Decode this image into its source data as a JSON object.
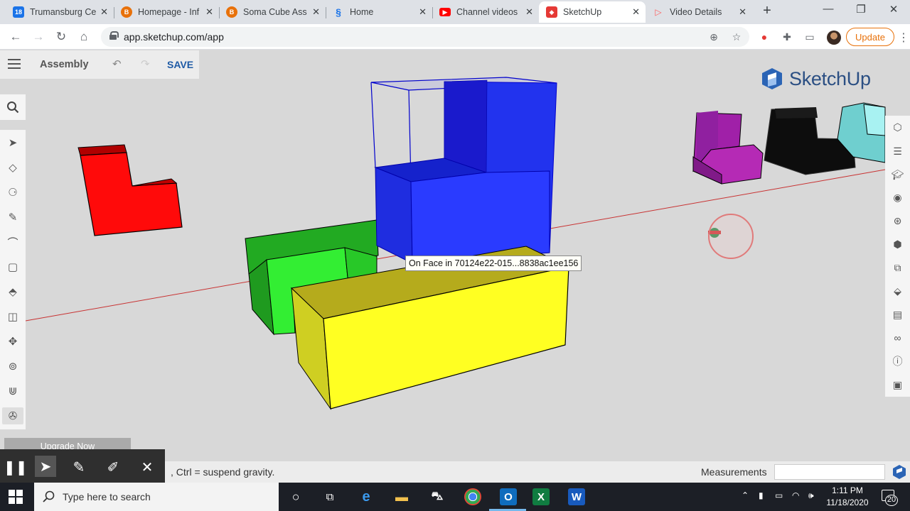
{
  "browser": {
    "tabs": [
      {
        "title": "Trumansburg Ce",
        "icon": "calendar-favicon",
        "color": "#1a73e8",
        "active": false
      },
      {
        "title": "Homepage - Inf",
        "icon": "orange-b-favicon",
        "color": "#e8710a",
        "active": false
      },
      {
        "title": "Soma Cube Ass",
        "icon": "orange-b-favicon",
        "color": "#e8710a",
        "active": false
      },
      {
        "title": "Home",
        "icon": "swirl-favicon",
        "color": "#1a73e8",
        "active": false
      },
      {
        "title": "Channel videos",
        "icon": "youtube-favicon",
        "color": "#ff0000",
        "active": false
      },
      {
        "title": "SketchUp",
        "icon": "sketchup-favicon",
        "color": "#e53935",
        "active": true
      },
      {
        "title": "Video Details",
        "icon": "youtube-studio-favicon",
        "color": "#ff5c5c",
        "active": false
      }
    ],
    "url": "app.sketchup.com/app",
    "update_label": "Update"
  },
  "app": {
    "document_name": "Assembly",
    "save_label": "SAVE",
    "logo_text": "SketchUp",
    "tooltip": "On Face in 70124e22-015...8838ac1ee156",
    "upgrade_label": "Upgrade Now",
    "status_hint": ", Ctrl = suspend gravity.",
    "measurements_label": "Measurements",
    "measurements_value": "",
    "accent_color": "#1e5aa5",
    "left_tools": [
      "select-icon",
      "eraser-icon",
      "paint-bucket-icon",
      "pencil-icon",
      "arc-icon",
      "rectangle-icon",
      "push-pull-icon",
      "offset-icon",
      "move-icon",
      "tape-measure-icon",
      "walk-icon",
      "orbit-icon"
    ],
    "right_tools": [
      "entity-info-icon",
      "outliner-icon",
      "instructor-icon",
      "styles-icon",
      "components-icon",
      "materials-icon",
      "tags-icon",
      "scenes-icon",
      "display-icon",
      "info-icon",
      "3d-warehouse-icon"
    ]
  },
  "taskbar": {
    "search_placeholder": "Type here to search",
    "time": "1:11 PM",
    "date": "11/18/2020",
    "notifications": "20"
  }
}
